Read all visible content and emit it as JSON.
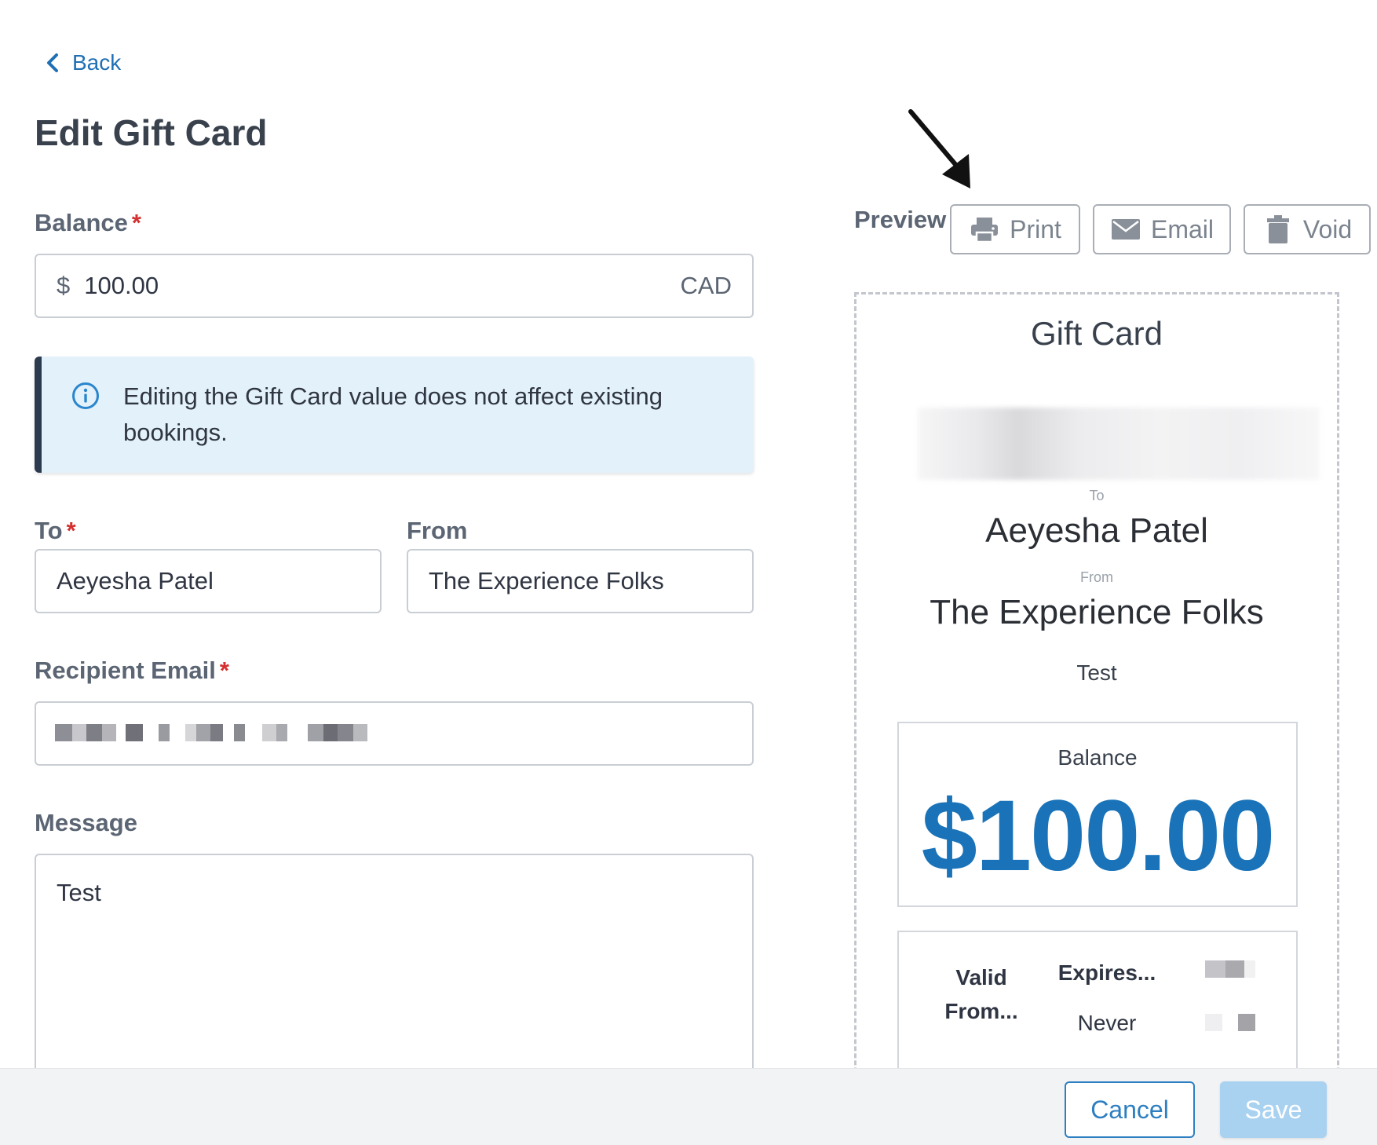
{
  "nav": {
    "back_label": "Back"
  },
  "page": {
    "title": "Edit Gift Card"
  },
  "form": {
    "balance": {
      "label": "Balance",
      "required": "*",
      "currency_symbol": "$",
      "value": "100.00",
      "currency_code": "CAD"
    },
    "notice": {
      "icon": "info-icon",
      "text": "Editing the Gift Card value does not affect existing bookings."
    },
    "to": {
      "label": "To",
      "required": "*",
      "value": "Aeyesha Patel"
    },
    "from": {
      "label": "From",
      "value": "The Experience Folks"
    },
    "recipient_email": {
      "label": "Recipient Email",
      "required": "*"
    },
    "message": {
      "label": "Message",
      "value": "Test"
    }
  },
  "preview": {
    "label": "Preview",
    "actions": [
      {
        "label": "Print",
        "icon": "printer-icon"
      },
      {
        "label": "Email",
        "icon": "envelope-icon"
      },
      {
        "label": "Void",
        "icon": "trash-icon"
      }
    ],
    "card": {
      "title": "Gift Card",
      "to_label": "To",
      "to_name": "Aeyesha Patel",
      "from_label": "From",
      "from_name": "The Experience Folks",
      "message": "Test",
      "balance_label": "Balance",
      "balance_amount": "$100.00",
      "valid_from_label": "Valid From...",
      "expires_label": "Expires...",
      "expires_value": "Never"
    }
  },
  "footer": {
    "cancel_label": "Cancel",
    "save_label": "Save"
  },
  "colors": {
    "accent": "#1f6fb5",
    "amount": "#1a73b8",
    "save_disabled": "#a9d2f1",
    "required": "#d3302f",
    "notice_bg": "#e3f1fa"
  }
}
